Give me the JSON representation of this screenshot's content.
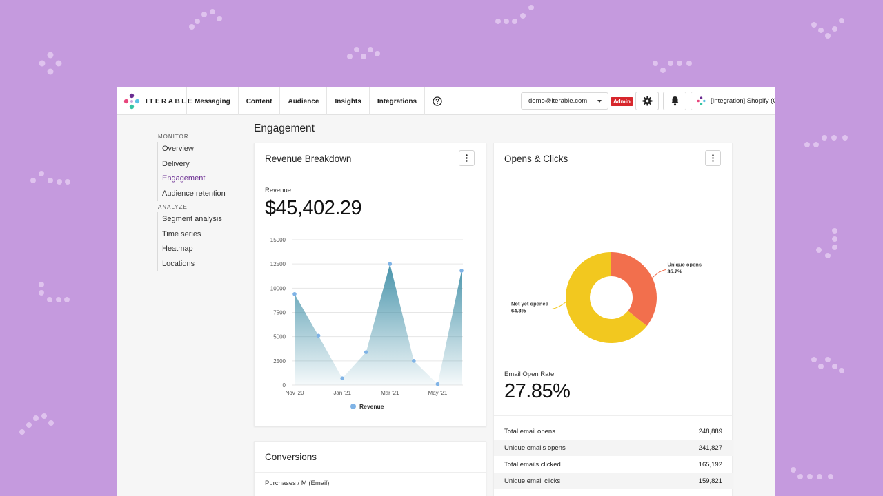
{
  "app": {
    "logo_text": "ITERABLE",
    "nav": [
      {
        "label": "Messaging"
      },
      {
        "label": "Content"
      },
      {
        "label": "Audience"
      },
      {
        "label": "Insights"
      },
      {
        "label": "Integrations"
      }
    ],
    "user_email": "demo@iterable.com",
    "admin_badge": "Admin",
    "project": "[Integration] Shopify (C"
  },
  "sidebar": {
    "sections": [
      {
        "title": "MONITOR",
        "items": [
          "Overview",
          "Delivery",
          "Engagement",
          "Audience retention"
        ]
      },
      {
        "title": "ANALYZE",
        "items": [
          "Segment analysis",
          "Time series",
          "Heatmap",
          "Locations"
        ]
      }
    ],
    "active": "Engagement"
  },
  "page": {
    "title": "Engagement"
  },
  "revenue_card": {
    "title": "Revenue Breakdown",
    "label": "Revenue",
    "value": "$45,402.29",
    "legend": "Revenue"
  },
  "opens_card": {
    "title": "Opens & Clicks",
    "rate_label": "Email Open Rate",
    "rate_value": "27.85%",
    "stats": [
      {
        "label": "Total email opens",
        "value": "248,889"
      },
      {
        "label": "Unique emails opens",
        "value": "241,827"
      },
      {
        "label": "Total emails clicked",
        "value": "165,192"
      },
      {
        "label": "Unique email clicks",
        "value": "159,821"
      }
    ]
  },
  "conversions_card": {
    "title": "Conversions",
    "label": "Purchases / M (Email)"
  },
  "colors": {
    "accent": "#6a2c91",
    "teal": "#4a96ab",
    "orange": "#f26f4d",
    "yellow": "#f2c81f",
    "point": "#7fb3e6"
  },
  "chart_data": [
    {
      "type": "area",
      "series": [
        {
          "name": "Revenue",
          "values": [
            9400,
            5100,
            700,
            3400,
            12500,
            2500,
            100,
            11800
          ]
        }
      ],
      "x_tick_labels": [
        "Nov '20",
        "Jan '21",
        "Mar '21",
        "May '21"
      ],
      "y_ticks": [
        0,
        2500,
        5000,
        7500,
        10000,
        12500,
        15000
      ],
      "ylim": [
        0,
        15000
      ],
      "grid": true,
      "legend": "bottom"
    },
    {
      "type": "pie",
      "donut": true,
      "slices": [
        {
          "label": "Unique opens",
          "value": 35.7,
          "display": "35.7%"
        },
        {
          "label": "Not yet opened",
          "value": 64.3,
          "display": "64.3%"
        }
      ]
    }
  ]
}
